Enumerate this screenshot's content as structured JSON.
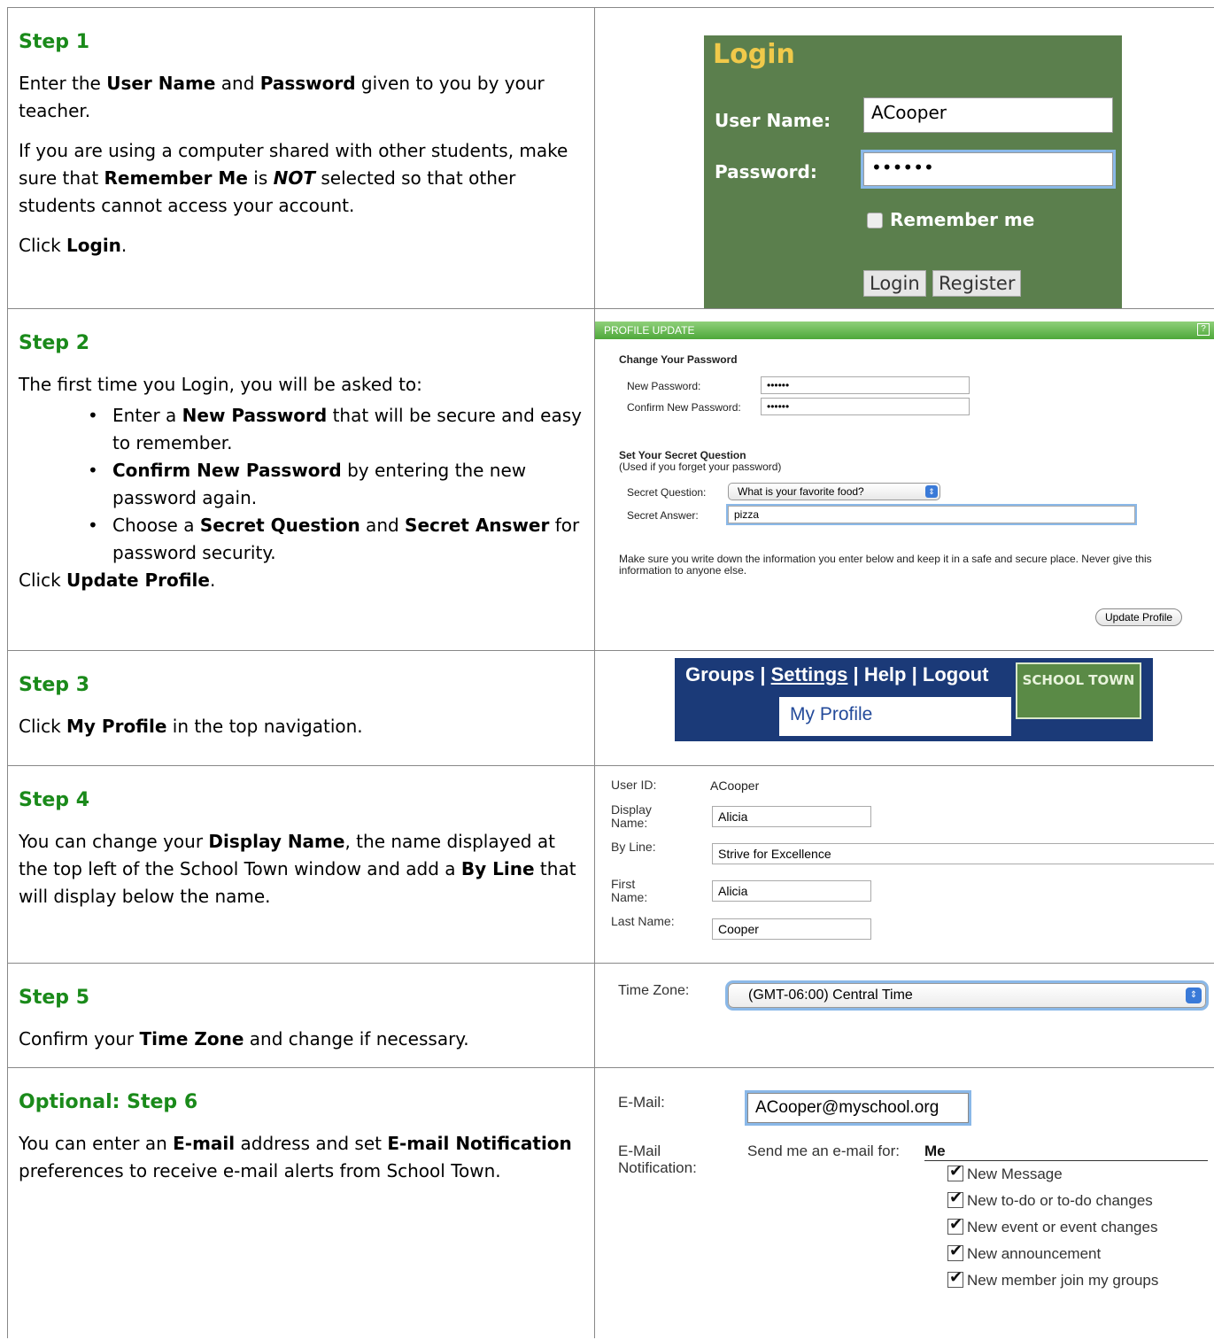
{
  "step1": {
    "title": "Step 1",
    "p1_a": "Enter the ",
    "p1_b": "User Name",
    "p1_c": " and ",
    "p1_d": "Password",
    "p1_e": " given to you by your teacher.",
    "p2_a": "If you are using a computer shared with other students, make sure that ",
    "p2_b": "Remember Me",
    "p2_c": " is ",
    "p2_d": "NOT",
    "p2_e": " selected so that other students cannot access your account.",
    "p3_a": "Click ",
    "p3_b": "Login",
    "p3_c": ".",
    "panel": {
      "title": "Login",
      "username_label": "User Name:",
      "username_value": "ACooper",
      "password_label": "Password:",
      "password_value": "••••••",
      "remember_label": "Remember me",
      "login_button": "Login",
      "register_button": "Register"
    }
  },
  "step2": {
    "title": "Step 2",
    "intro": "The first time you Login, you will be asked to:",
    "b1_a": "Enter a ",
    "b1_b": "New Password",
    "b1_c": " that will be secure and easy to remember.",
    "b2_a": "Confirm New Password",
    "b2_b": " by entering the new password again.",
    "b3_a": "Choose a ",
    "b3_b": "Secret Question",
    "b3_c": " and ",
    "b3_d": "Secret Answer",
    "b3_e": " for password security.",
    "click_a": "Click ",
    "click_b": "Update Profile",
    "click_c": ".",
    "panel": {
      "bar_title": "PROFILE UPDATE",
      "help": "?",
      "change_pw": "Change Your Password",
      "new_pw_label": "New Password:",
      "new_pw_value": "••••••",
      "confirm_pw_label": "Confirm New Password:",
      "confirm_pw_value": "••••••",
      "secret_heading": "Set Your Secret Question",
      "secret_sub": "(Used if you forget your password)",
      "question_label": "Secret Question:",
      "question_value": "What is your favorite food?",
      "answer_label": "Secret Answer:",
      "answer_value": "pizza",
      "note": "Make sure you write down the information you enter below and keep it in a safe and secure place. Never give this information to anyone else.",
      "update_button": "Update Profile"
    }
  },
  "step3": {
    "title": "Step 3",
    "text_a": "Click ",
    "text_b": "My Profile",
    "text_c": " in the top navigation.",
    "nav": {
      "groups": "Groups",
      "sep": " | ",
      "settings": "Settings",
      "help": "Help",
      "logout": "Logout",
      "dropdown_item": "My Profile",
      "logo_text": "SCHOOL TOWN"
    }
  },
  "step4": {
    "title": "Step 4",
    "text_a": "You can change your ",
    "text_b": "Display Name",
    "text_c": ", the name displayed at the top left of the School Town window and add a ",
    "text_d": "By Line",
    "text_e": " that will display below the name.",
    "fields": {
      "userid_label": "User ID:",
      "userid_value": "ACooper",
      "display_label": "Display Name:",
      "display_value": "Alicia",
      "byline_label": "By Line:",
      "byline_value": "Strive for Excellence",
      "first_label": "First Name:",
      "first_value": "Alicia",
      "last_label": "Last Name:",
      "last_value": "Cooper"
    }
  },
  "step5": {
    "title": "Step 5",
    "text_a": "Confirm your ",
    "text_b": "Time Zone",
    "text_c": " and change if necessary.",
    "tz_label": "Time Zone:",
    "tz_value": "(GMT-06:00) Central Time"
  },
  "step6": {
    "title": "Optional: Step 6",
    "text_a": "You can enter an ",
    "text_b": "E-mail",
    "text_c": " address and set ",
    "text_d": "E-mail Notification",
    "text_e": " preferences to receive e-mail alerts from School Town.",
    "email_label": "E-Mail:",
    "email_value": "ACooper@myschool.org",
    "notif_label": "E-Mail Notification:",
    "send_label": "Send me an e-mail for:",
    "me": "Me",
    "options": [
      "New Message",
      "New to-do or to-do changes",
      "New event or event changes",
      "New announcement",
      "New member join my groups"
    ]
  }
}
